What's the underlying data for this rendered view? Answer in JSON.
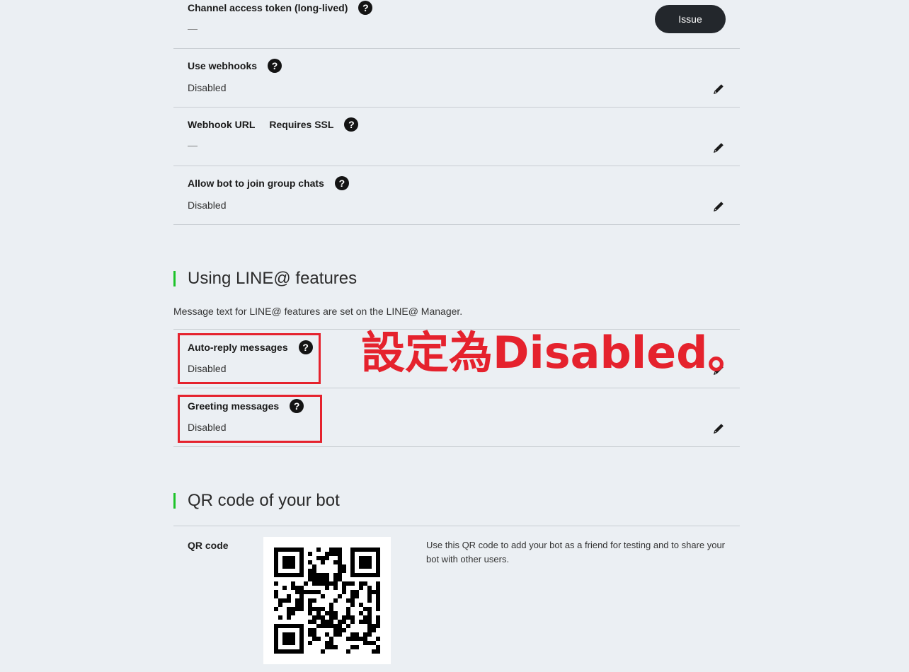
{
  "settings": [
    {
      "label": "Channel access token (long-lived)",
      "sub": "",
      "value": "—",
      "action": "Issue"
    },
    {
      "label": "Use webhooks",
      "sub": "",
      "value": "Disabled"
    },
    {
      "label": "Webhook URL",
      "sub": "Requires SSL",
      "value": "—"
    },
    {
      "label": "Allow bot to join group chats",
      "sub": "",
      "value": "Disabled"
    }
  ],
  "line_section": {
    "title": "Using LINE@ features",
    "description": "Message text for LINE@ features are set on the LINE@ Manager.",
    "rows": [
      {
        "label": "Auto-reply messages",
        "value": "Disabled"
      },
      {
        "label": "Greeting messages",
        "value": "Disabled"
      }
    ]
  },
  "annotation": "設定為Disabled。",
  "qr_section": {
    "title": "QR code of your bot",
    "label": "QR code",
    "description": "Use this QR code to add your bot as a friend for testing and to share your bot with other users."
  },
  "help_glyph": "?",
  "colors": {
    "accent_bar": "#1dc329",
    "highlight": "#e5222d",
    "button": "#23272c"
  }
}
